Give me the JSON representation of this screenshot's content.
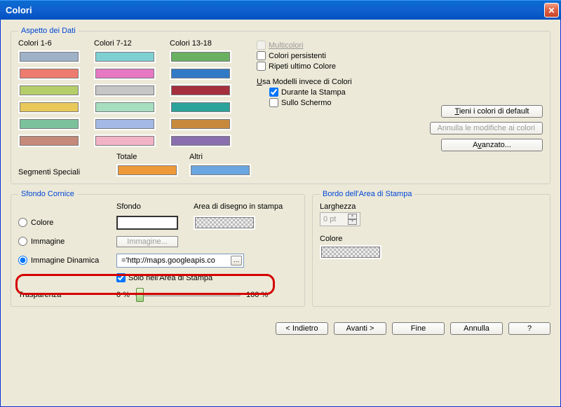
{
  "title": "Colori",
  "aspetto": {
    "legend": "Aspetto dei Dati",
    "col1_label": "Colori 1-6",
    "col2_label": "Colori 7-12",
    "col3_label": "Colori 13-18",
    "multicolori": "Multicolori",
    "persistenti": "Colori persistenti",
    "ripeti": "Ripeti ultimo Colore",
    "usa_modelli": "Usa Modelli invece di Colori",
    "durante_stampa": "Durante la Stampa",
    "sullo_schermo": "Sullo Schermo",
    "tieni": "Tieni i colori di default",
    "annulla_mod": "Annulla le modifiche ai colori",
    "avanzato": "Avanzato...",
    "segmenti": "Segmenti Speciali",
    "totale": "Totale",
    "altri": "Altri"
  },
  "sfondo": {
    "legend": "Sfondo Cornice",
    "hdr_sfondo": "Sfondo",
    "hdr_area": "Area di disegno in stampa",
    "colore": "Colore",
    "immagine": "Immagine",
    "immagine_btn": "Immagine...",
    "immagine_din": "Immagine Dinamica",
    "formula": "='http://maps.googleapis.co",
    "solo_area": "Solo nell'Area di Stampa",
    "trasparenza": "Trasparenza",
    "p0": "0 %",
    "p100": "100 %"
  },
  "bordo": {
    "legend": "Bordo dell'Area di Stampa",
    "larghezza": "Larghezza",
    "val": "0 pt",
    "colore": "Colore"
  },
  "footer": {
    "indietro": "< Indietro",
    "avanti": "Avanti >",
    "fine": "Fine",
    "annulla": "Annulla",
    "help": "?"
  },
  "swatches": {
    "c1": [
      "#9fb2c8",
      "#ed7b6e",
      "#b6ce6a",
      "#e9c95a",
      "#7bc29c",
      "#c58a79"
    ],
    "c2": [
      "#7fd0d3",
      "#e679c2",
      "#c6c6c6",
      "#a7dec0",
      "#a4b9e5",
      "#f3b3c7"
    ],
    "c3": [
      "#69b061",
      "#3279c6",
      "#a52f3c",
      "#2aa39a",
      "#c78a3d",
      "#8a6fae"
    ],
    "totale": "#ee9a3a",
    "altri": "#6aa7e0"
  }
}
